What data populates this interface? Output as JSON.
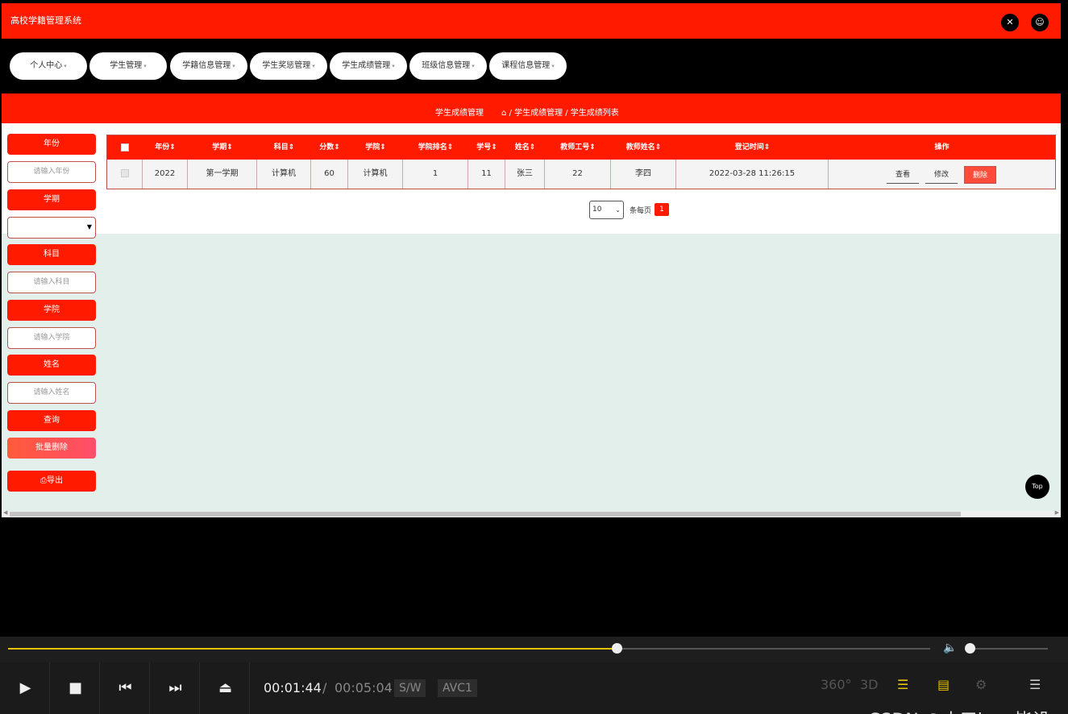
{
  "app": {
    "title": "高校学籍管理系统",
    "fullscreen_icon": "fullscreen-exit-icon",
    "user_icon": "user-icon",
    "menu": [
      {
        "label": "个人中心",
        "caret": "▾"
      },
      {
        "label": "学生管理",
        "caret": "▾"
      },
      {
        "label": "学籍信息管理",
        "caret": "▾"
      },
      {
        "label": "学生奖惩管理",
        "caret": "▾"
      },
      {
        "label": "学生成绩管理",
        "caret": "▾"
      },
      {
        "label": "班级信息管理",
        "caret": "▾"
      },
      {
        "label": "课程信息管理",
        "caret": "▾"
      }
    ],
    "crumb": {
      "title": "学生成绩管理",
      "home_icon": "⌂",
      "path": " / 学生成绩管理 / 学生成绩列表"
    },
    "filters": {
      "year_label": "年份",
      "year_placeholder": "请输入年份",
      "term_label": "学期",
      "term_value": "",
      "subject_label": "科目",
      "subject_placeholder": "请输入科目",
      "college_label": "学院",
      "college_placeholder": "请输入学院",
      "name_label": "姓名",
      "name_placeholder": "请输入姓名",
      "query_label": "查询",
      "batch_delete_label": "批量删除",
      "export_label": "⎙导出"
    },
    "table": {
      "headers": [
        "年份",
        "学期",
        "科目",
        "分数",
        "学院",
        "学院排名",
        "学号",
        "姓名",
        "教师工号",
        "教师姓名",
        "登记时间",
        "操作"
      ],
      "sort_mark": "⇕",
      "rows": [
        {
          "year": "2022",
          "term": "第一学期",
          "subject": "计算机",
          "score": "60",
          "college": "计算机",
          "rank": "1",
          "student_no": "11",
          "name": "张三",
          "teacher_no": "22",
          "teacher_name": "李四",
          "time": "2022-03-28 11:26:15"
        }
      ],
      "actions": {
        "view": "查看",
        "edit": "修改",
        "delete": "删除"
      }
    },
    "pager": {
      "page_size": "10",
      "per_page_text": "条每页",
      "current_page": "1"
    },
    "top_button": "Top"
  },
  "player": {
    "progress": 0.66,
    "volume": 0.0,
    "time_current": "00:01:44",
    "time_sep": "/",
    "time_total": "00:05:04",
    "tag_sw": "S/W",
    "tag_codec": "AVC1",
    "icon_360": "360°",
    "icon_3d": "3D",
    "watermark": "CSDN @小五java毕设",
    "accent": "#e5c100"
  }
}
